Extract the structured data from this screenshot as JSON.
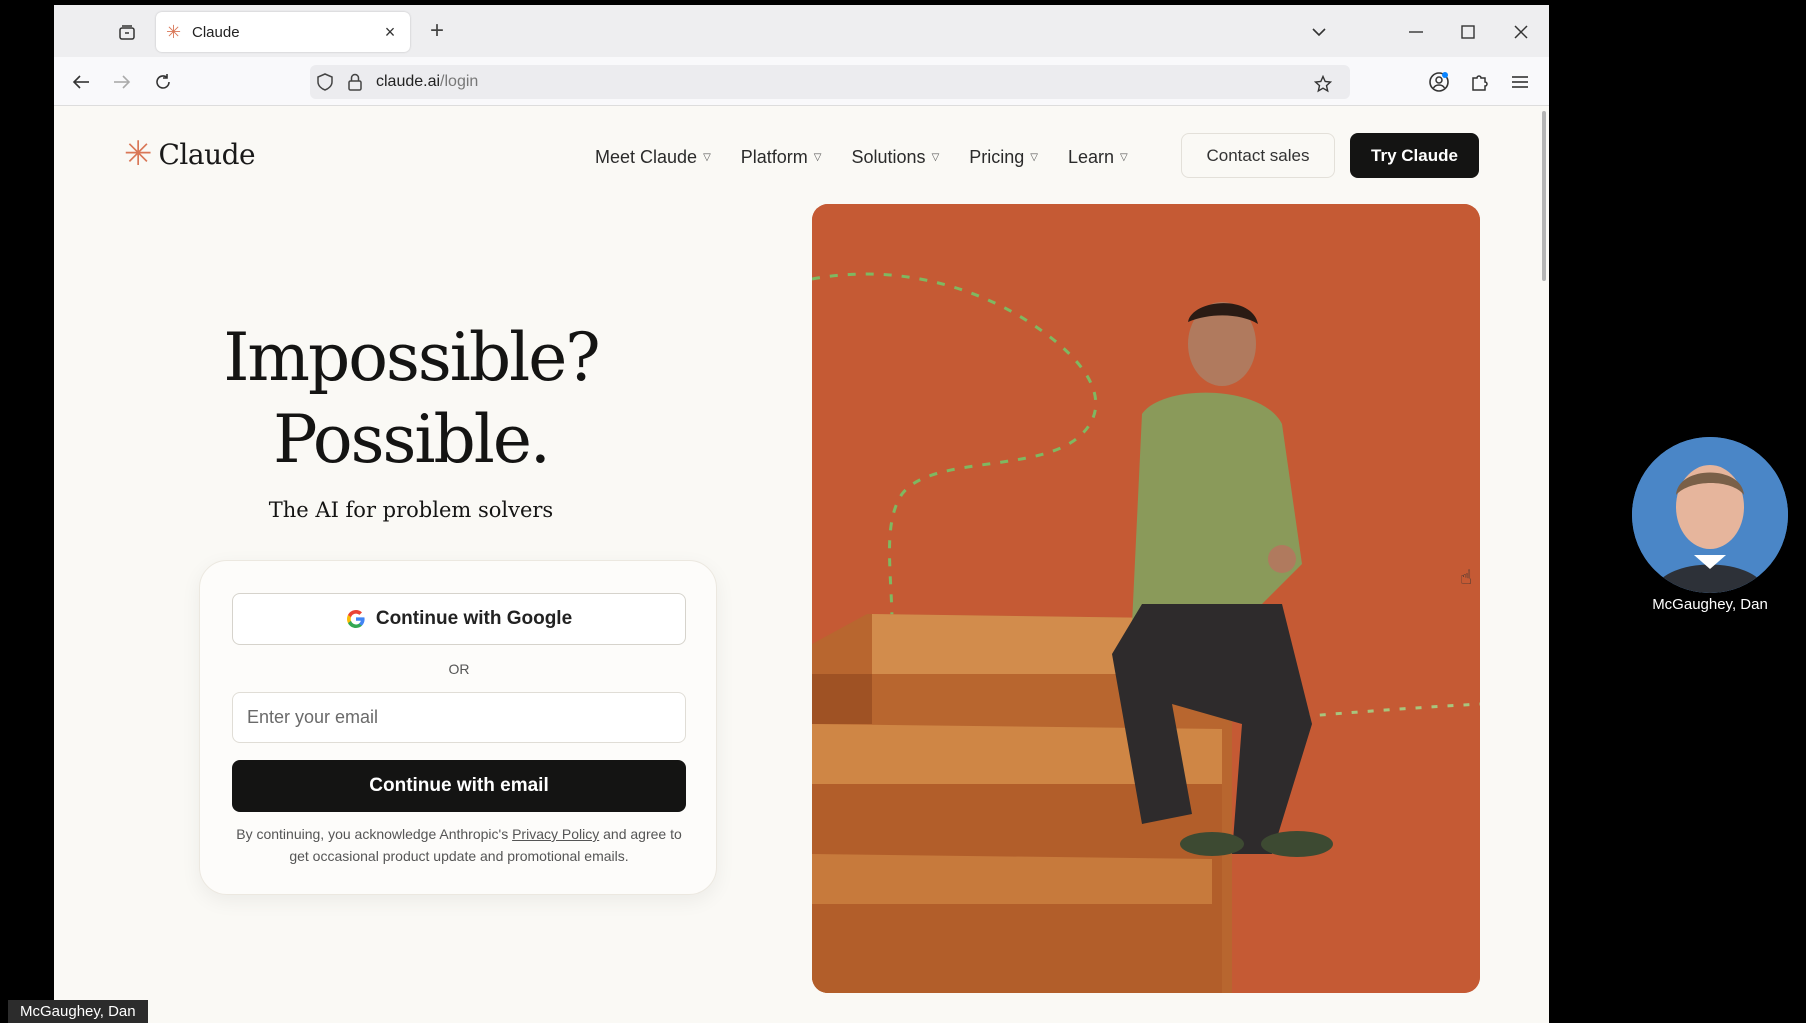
{
  "browser": {
    "tab_title": "Claude",
    "url_host": "claude.ai",
    "url_path": "/login"
  },
  "site": {
    "logo_text": "Claude",
    "nav": [
      "Meet Claude",
      "Platform",
      "Solutions",
      "Pricing",
      "Learn"
    ],
    "contact_label": "Contact sales",
    "try_label": "Try Claude"
  },
  "hero": {
    "headline_line1": "Impossible?",
    "headline_line2": "Possible.",
    "subhead": "The AI for problem solvers"
  },
  "login": {
    "google_label": "Continue with Google",
    "or_label": "OR",
    "email_placeholder": "Enter your email",
    "email_button": "Continue with email",
    "legal_prefix": "By continuing, you acknowledge Anthropic's",
    "privacy_link": "Privacy Policy",
    "legal_suffix": "and agree to get occasional product update and promotional emails."
  },
  "meeting": {
    "participant_name": "McGaughey, Dan",
    "bottom_label": "McGaughey, Dan"
  },
  "colors": {
    "brand": "#d97757",
    "dark": "#141413",
    "page_bg": "#faf9f5",
    "hero_bg": "#c55a34"
  }
}
